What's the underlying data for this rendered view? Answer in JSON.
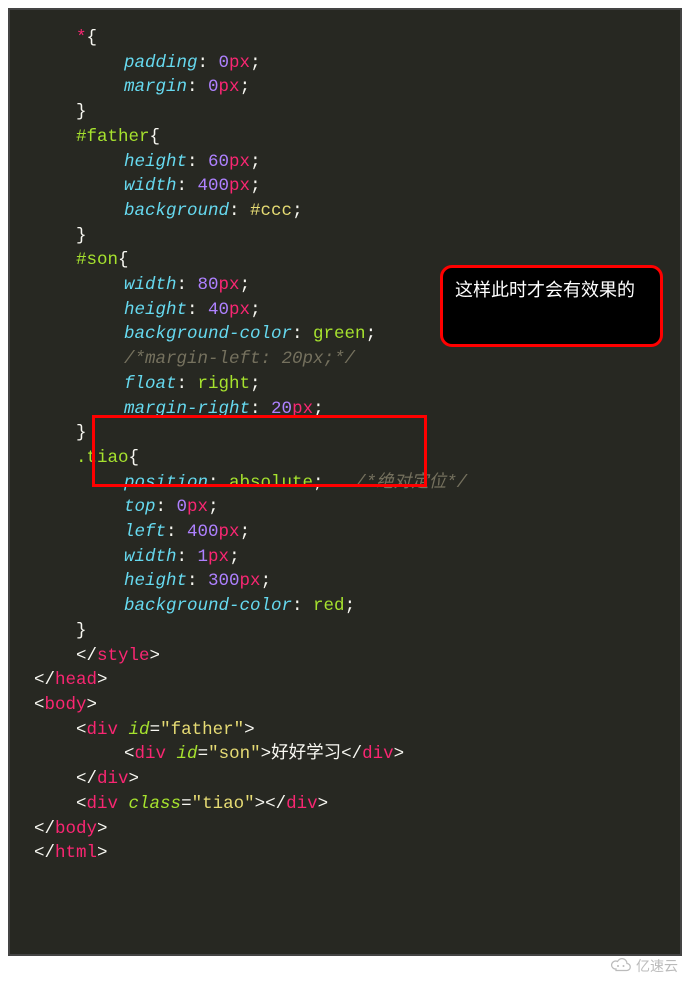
{
  "note": "这样此时才会有效果的",
  "watermark": "亿速云",
  "code": {
    "star": "*",
    "brace_open": "{",
    "brace_close": "}",
    "colon": ": ",
    "semi": ";",
    "father_sel": "#father",
    "son_sel": "#son",
    "tiao_sel": ".tiao",
    "padding": "padding",
    "margin": "margin",
    "height": "height",
    "width": "width",
    "background": "background",
    "background_color": "background-color",
    "float": "float",
    "margin_right": "margin-right",
    "position": "position",
    "top": "top",
    "left": "left",
    "v0": "0",
    "v60": "60",
    "v400": "400",
    "v80": "80",
    "v40": "40",
    "v20": "20",
    "v1": "1",
    "v300": "300",
    "px": "px",
    "ccc": "#ccc",
    "green": "green",
    "right": "right",
    "absolute": "absolute",
    "red": "red",
    "comment_margin": "/*margin-left: 20px;*/",
    "comment_abs": "/*绝对定位*/",
    "lt": "<",
    "gt": ">",
    "slash": "/",
    "eq": "=",
    "style_tag": "style",
    "head_tag": "head",
    "body_tag": "body",
    "div_tag": "div",
    "html_tag": "html",
    "id_attr": "id",
    "class_attr": "class",
    "father_str": "\"father\"",
    "son_str": "\"son\"",
    "tiao_str": "\"tiao\"",
    "son_text": "好好学习"
  }
}
